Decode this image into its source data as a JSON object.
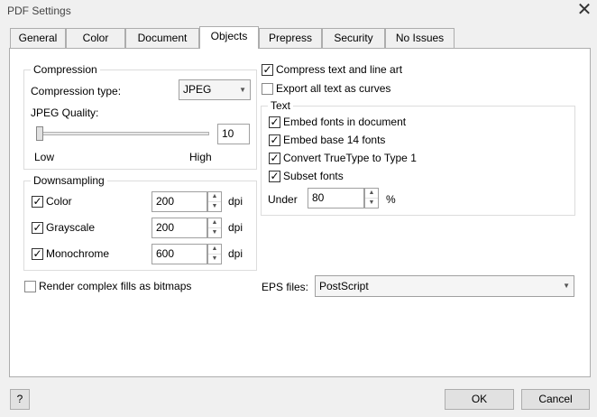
{
  "window": {
    "title": "PDF Settings",
    "close_glyph": "✕"
  },
  "tabs": [
    {
      "label": "General"
    },
    {
      "label": "Color"
    },
    {
      "label": "Document"
    },
    {
      "label": "Objects"
    },
    {
      "label": "Prepress"
    },
    {
      "label": "Security"
    },
    {
      "label": "No Issues"
    }
  ],
  "active_tab": "Objects",
  "compression": {
    "title": "Compression",
    "type_label": "Compression type:",
    "type_value": "JPEG",
    "quality_label": "JPEG Quality:",
    "quality_value": "10",
    "slider_level": 0.02,
    "low_label": "Low",
    "high_label": "High"
  },
  "downsampling": {
    "title": "Downsampling",
    "unit": "dpi",
    "rows": [
      {
        "label": "Color",
        "value": "200",
        "checked": true
      },
      {
        "label": "Grayscale",
        "value": "200",
        "checked": true
      },
      {
        "label": "Monochrome",
        "value": "600",
        "checked": true
      }
    ]
  },
  "render_complex": {
    "label": "Render complex fills as bitmaps",
    "checked": false
  },
  "compress_text": {
    "label": "Compress text and line art",
    "checked": true
  },
  "export_curves": {
    "label": "Export all text as curves",
    "checked": false
  },
  "text_group": {
    "title": "Text",
    "items": [
      {
        "label": "Embed fonts in document",
        "checked": true
      },
      {
        "label": "Embed base 14 fonts",
        "checked": true
      },
      {
        "label": "Convert TrueType to Type 1",
        "checked": true
      },
      {
        "label": "Subset fonts",
        "checked": true
      }
    ],
    "under_label": "Under",
    "under_value": "80",
    "under_unit": "%"
  },
  "eps": {
    "label": "EPS files:",
    "value": "PostScript"
  },
  "footer": {
    "help": "?",
    "ok": "OK",
    "cancel": "Cancel"
  },
  "glyphs": {
    "check": "✓",
    "up": "▲",
    "down": "▼",
    "combo_arrow": "▼"
  }
}
